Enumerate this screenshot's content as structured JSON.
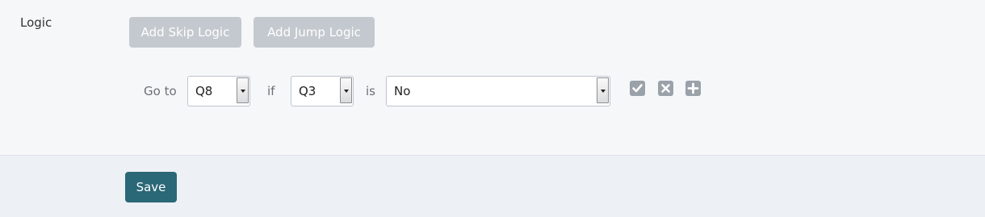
{
  "logic": {
    "label": "Logic",
    "add_skip_label": "Add Skip Logic",
    "add_jump_label": "Add Jump Logic",
    "rule": {
      "goto_text": "Go to",
      "goto_value": "Q8",
      "if_text": "if",
      "if_value": "Q3",
      "is_text": "is",
      "is_value": "No",
      "actions": {
        "confirm_icon": "check-icon",
        "remove_icon": "close-icon",
        "add_icon": "plus-icon"
      }
    }
  },
  "footer": {
    "save_label": "Save"
  },
  "colors": {
    "accent": "#2a6777",
    "disabled_button": "#c4c9cf",
    "icon_button": "#9aa1a9"
  }
}
